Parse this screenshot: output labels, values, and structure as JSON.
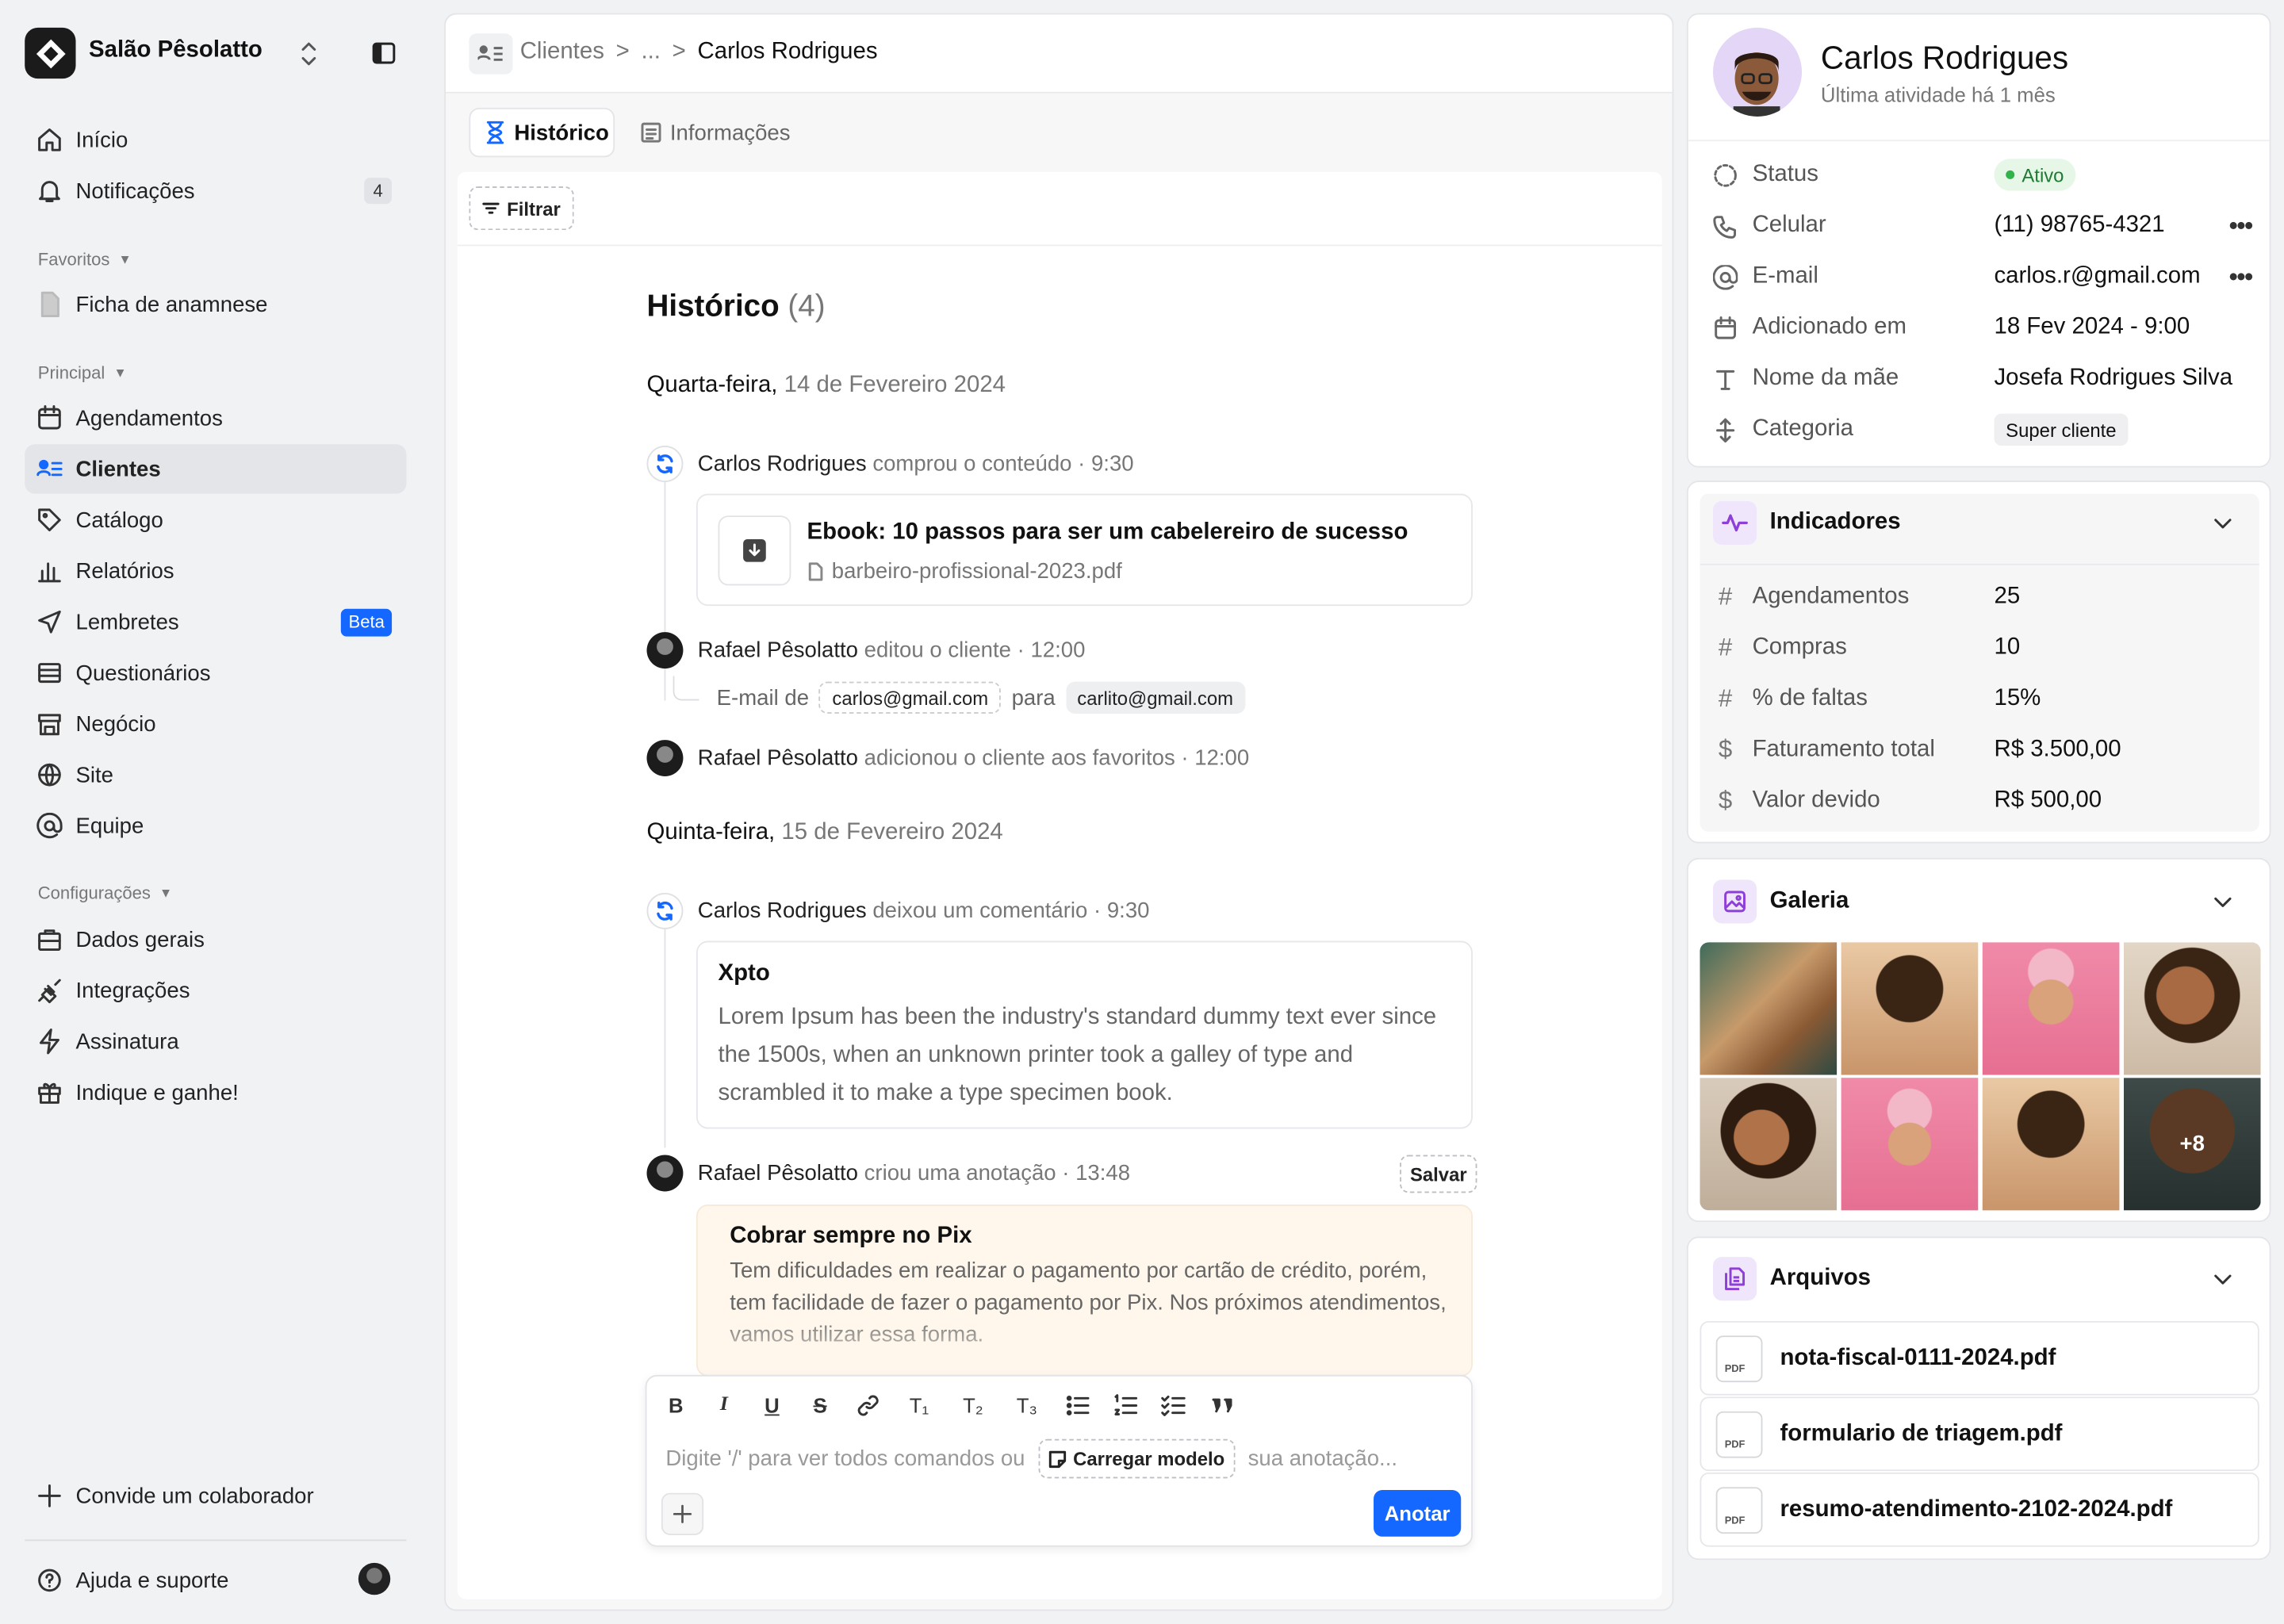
{
  "workspace": {
    "name": "Salão Pêsolatto"
  },
  "nav": {
    "inicio": "Início",
    "notificacoes": "Notificações",
    "notificacoes_count": "4",
    "favoritos_title": "Favoritos",
    "ficha": "Ficha de anamnese",
    "principal_title": "Principal",
    "agendamentos": "Agendamentos",
    "clientes": "Clientes",
    "catalogo": "Catálogo",
    "relatorios": "Relatórios",
    "lembretes": "Lembretes",
    "beta": "Beta",
    "questionarios": "Questionários",
    "negocio": "Negócio",
    "site": "Site",
    "equipe": "Equipe",
    "config_title": "Configurações",
    "dados": "Dados gerais",
    "integracoes": "Integrações",
    "assinatura": "Assinatura",
    "indique": "Indique e ganhe!",
    "convide": "Convide um colaborador",
    "ajuda": "Ajuda e suporte"
  },
  "breadcrumb": {
    "root": "Clientes",
    "sep1": ">",
    "ellipsis": "...",
    "sep2": ">",
    "current": "Carlos Rodrigues"
  },
  "tabs": {
    "historico": "Histórico",
    "informacoes": "Informações"
  },
  "filter": "Filtrar",
  "history": {
    "title": "Histórico",
    "count": "(4)",
    "day1_weekday": "Quarta-feira,",
    "day1_date": "14 de Fevereiro 2024",
    "e1_name": "Carlos Rodrigues",
    "e1_action": "comprou o conteúdo · 9:30",
    "e1_title": "Ebook: 10 passos para ser um cabelereiro de sucesso",
    "e1_file": "barbeiro-profissional-2023.pdf",
    "e2_name": "Rafael Pêsolatto",
    "e2_action": "editou o cliente · 12:00",
    "e2_from": "E-mail de",
    "e2_old": "carlos@gmail.com",
    "e2_to": "para",
    "e2_new": "carlito@gmail.com",
    "e3_name": "Rafael Pêsolatto",
    "e3_action": "adicionou o cliente aos favoritos · 12:00",
    "day2_weekday": "Quinta-feira,",
    "day2_date": "15 de Fevereiro 2024",
    "e4_name": "Carlos Rodrigues",
    "e4_action": "deixou um comentário · 9:30",
    "e4_title": "Xpto",
    "e4_body": "Lorem Ipsum has been the industry's standard dummy text ever since the 1500s, when an unknown printer took a galley of type and scrambled it to make a type specimen book.",
    "e5_name": "Rafael Pêsolatto",
    "e5_action": "criou uma anotação · 13:48",
    "e5_save": "Salvar",
    "e5_title": "Cobrar sempre no Pix",
    "e5_body": "Tem dificuldades em realizar o pagamento por cartão de crédito, porém, tem facilidade de fazer o pagamento por Pix. Nos próximos atendimentos, vamos utilizar essa forma."
  },
  "editor": {
    "placeholder_a": "Digite '/' para ver todos comandos ou",
    "template": "Carregar modelo",
    "placeholder_b": "sua anotação...",
    "submit": "Anotar",
    "t1": "T₁",
    "t2": "T₂",
    "t3": "T₃",
    "bold": "B",
    "italic": "I",
    "underline": "U",
    "strike": "S"
  },
  "profile": {
    "name": "Carlos Rodrigues",
    "subtitle": "Última atividade há 1 mês",
    "status_label": "Status",
    "status_value": "Ativo",
    "phone_label": "Celular",
    "phone_value": "(11) 98765-4321",
    "email_label": "E-mail",
    "email_value": "carlos.r@gmail.com",
    "added_label": "Adicionado em",
    "added_value": "18 Fev 2024 - 9:00",
    "mother_label": "Nome da mãe",
    "mother_value": "Josefa Rodrigues Silva",
    "category_label": "Categoria",
    "category_value": "Super cliente"
  },
  "indicators": {
    "title": "Indicadores",
    "items": [
      {
        "label": "Agendamentos",
        "value": "25"
      },
      {
        "label": "Compras",
        "value": "10"
      },
      {
        "label": "% de faltas",
        "value": "15%"
      },
      {
        "label": "Faturamento total",
        "value": "R$ 3.500,00"
      },
      {
        "label": "Valor devido",
        "value": "R$ 500,00"
      }
    ]
  },
  "gallery": {
    "title": "Galeria",
    "more": "+8"
  },
  "files": {
    "title": "Arquivos",
    "pdf_tag": "PDF",
    "items": [
      "nota-fiscal-0111-2024.pdf",
      "formulario de triagem.pdf",
      "resumo-atendimento-2102-2024.pdf"
    ]
  },
  "colors": {
    "accent": "#1468ff",
    "active_green": "#2fb34a",
    "purple": "#8e3fd8",
    "note_bg": "#fff7ec"
  }
}
